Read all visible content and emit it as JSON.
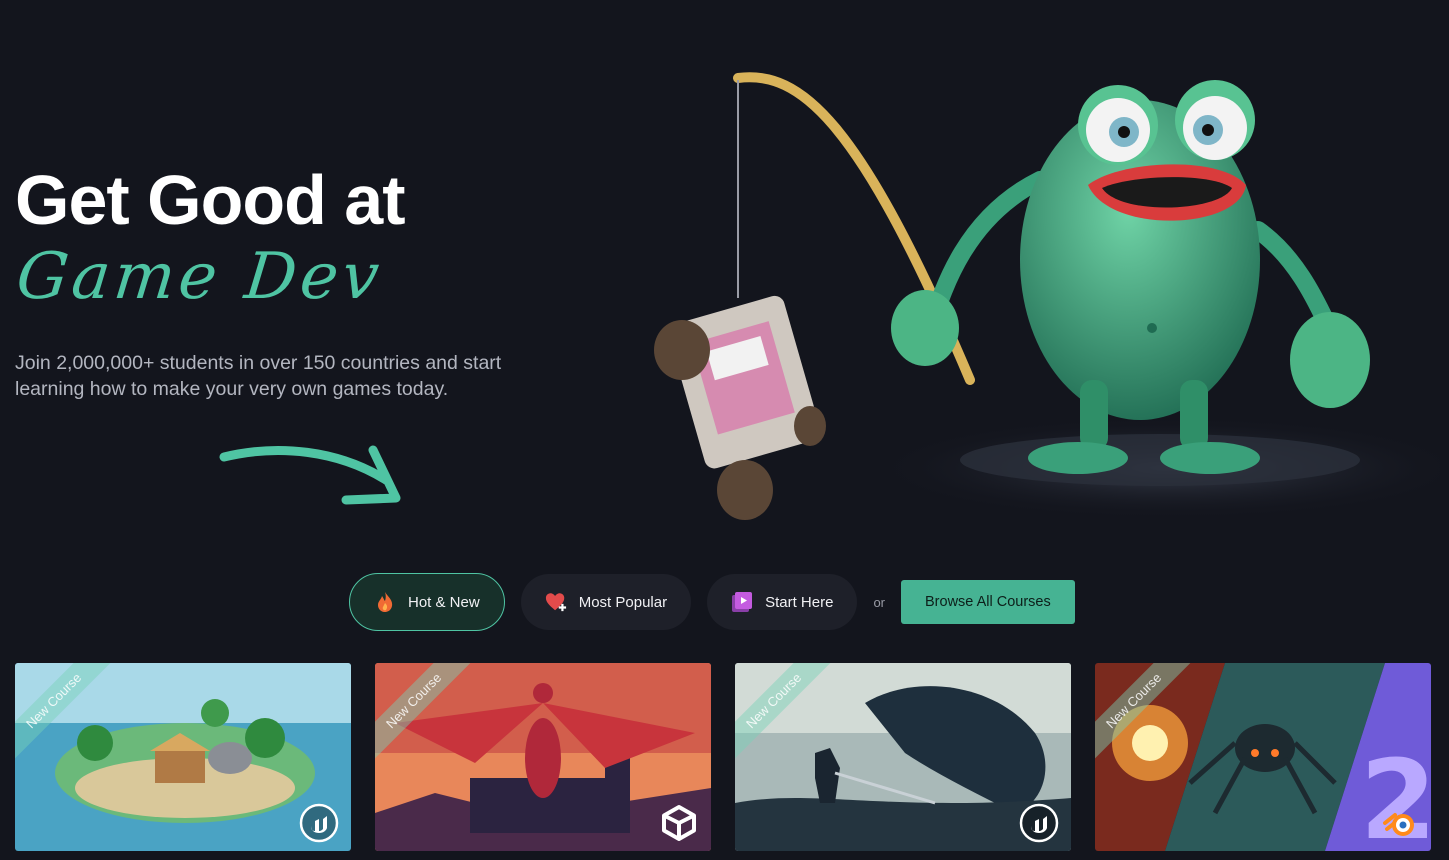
{
  "hero": {
    "title": "Get Good at",
    "script_title": "Game Dev",
    "subtitle": "Join 2,000,000+ students in over 150 countries and start learning how to make your very own games today."
  },
  "filters": {
    "tabs": [
      {
        "label": "Hot & New",
        "icon": "fire-icon",
        "active": true
      },
      {
        "label": "Most Popular",
        "icon": "heart-plus-icon",
        "active": false
      },
      {
        "label": "Start Here",
        "icon": "video-icon",
        "active": false
      }
    ],
    "or_label": "or",
    "browse_label": "Browse All Courses"
  },
  "courses": [
    {
      "ribbon": "New Course",
      "engine_icon": "unreal-engine-icon"
    },
    {
      "ribbon": "New Course",
      "engine_icon": "unity-icon"
    },
    {
      "ribbon": "New Course",
      "engine_icon": "unreal-engine-icon"
    },
    {
      "ribbon": "New Course",
      "engine_icon": "blender-icon"
    }
  ],
  "colors": {
    "background": "#13151d",
    "accent": "#4fc4a3",
    "button": "#46b393",
    "pill": "#1e2029"
  }
}
